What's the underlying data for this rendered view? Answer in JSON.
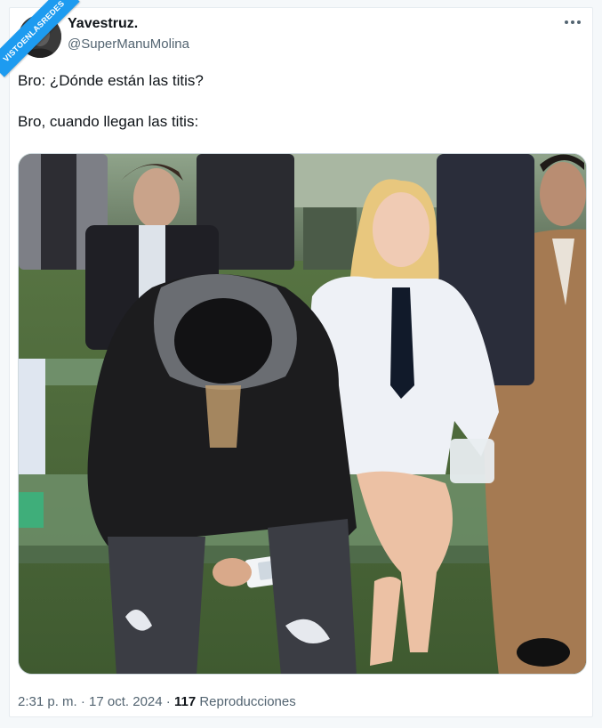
{
  "watermark": {
    "text": "VISTOENLASREDES"
  },
  "tweet": {
    "display_name": "Yavestruz.",
    "handle": "@SuperManuMolina",
    "more_icon": "more-horizontal-icon",
    "text_line_1": "Bro: ¿Dónde están las titis?",
    "text_line_2": "Bro, cuando llegan las titis:",
    "time": "2:31 p. m.",
    "sep1": " · ",
    "date": "17 oct. 2024",
    "sep2": " · ",
    "views_count": "117",
    "views_label": " Reproducciones"
  },
  "media": {
    "description_icon": "photo-of-people-seated-at-outdoor-event",
    "colors": {
      "lawn": "#4f6b3a",
      "bench": "#6f8f6a",
      "hoodie": "#1c1c1e",
      "white_suit": "#eef1f6",
      "tan_coat": "#a57a52",
      "hair": "#e8c77e"
    }
  },
  "colors": {
    "accent": "#1d9bf0",
    "text_primary": "#0f1419",
    "text_secondary": "#536471",
    "border": "#cfd9de"
  }
}
